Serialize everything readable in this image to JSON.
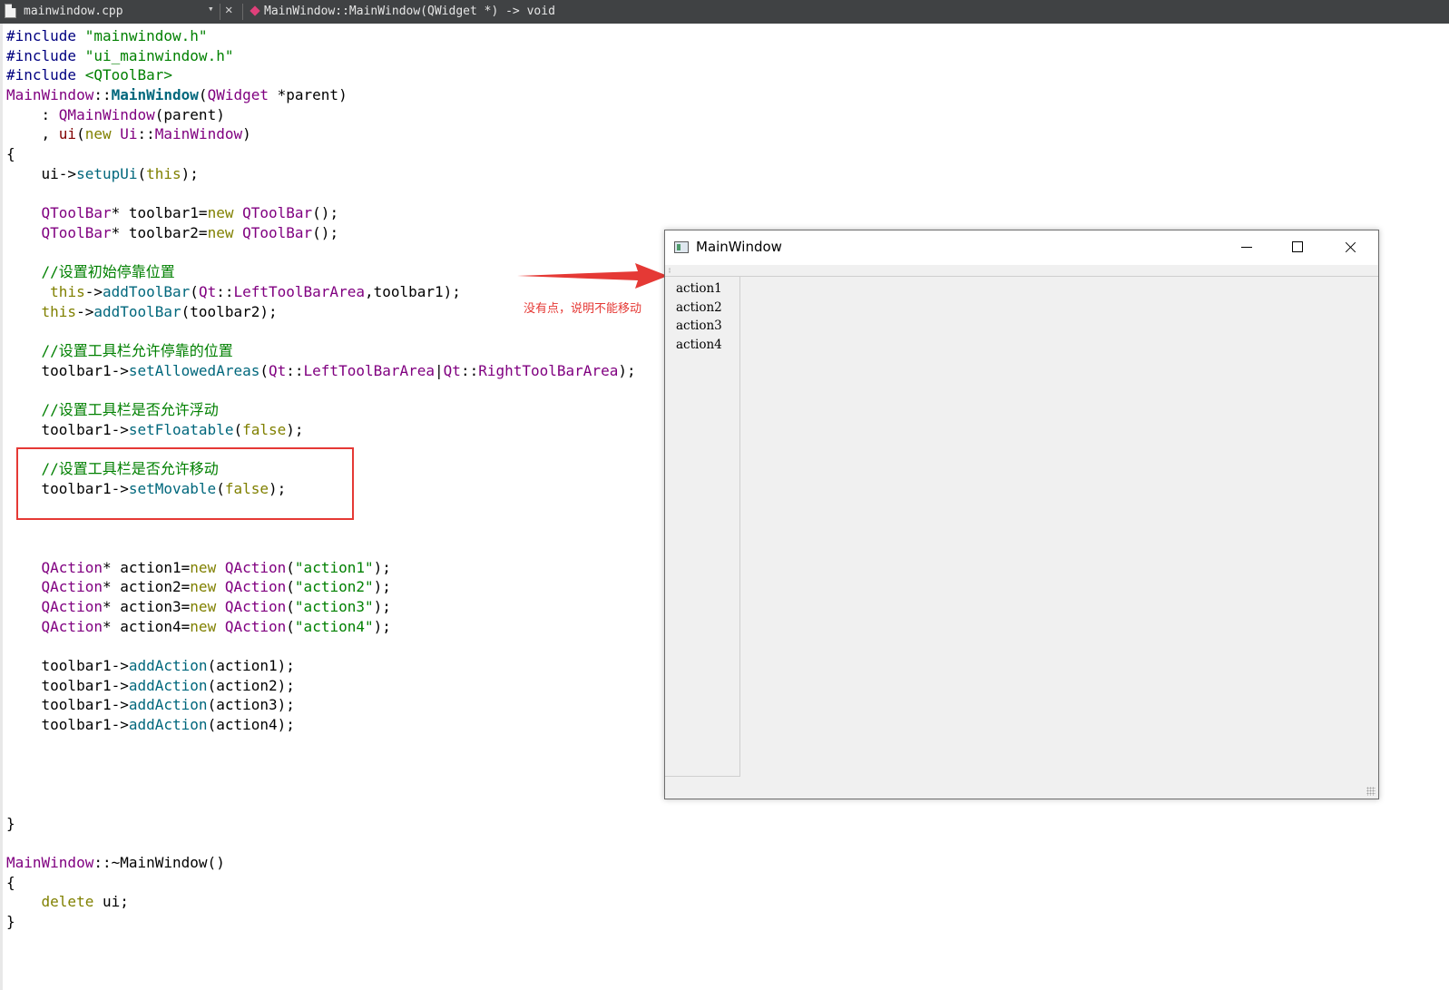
{
  "editor": {
    "tab_file": "mainwindow.cpp",
    "tab_symbol": "MainWindow::MainWindow(QWidget *) -> void"
  },
  "code_lines": [
    "#include \"mainwindow.h\"",
    "#include \"ui_mainwindow.h\"",
    "#include <QToolBar>",
    "MainWindow::MainWindow(QWidget *parent)",
    "    : QMainWindow(parent)",
    "    , ui(new Ui::MainWindow)",
    "{",
    "    ui->setupUi(this);",
    "",
    "    QToolBar* toolbar1=new QToolBar();",
    "    QToolBar* toolbar2=new QToolBar();",
    "",
    "    //设置初始停靠位置",
    "     this->addToolBar(Qt::LeftToolBarArea,toolbar1);",
    "    this->addToolBar(toolbar2);",
    "",
    "    //设置工具栏允许停靠的位置",
    "    toolbar1->setAllowedAreas(Qt::LeftToolBarArea|Qt::RightToolBarArea);",
    "",
    "    //设置工具栏是否允许浮动",
    "    toolbar1->setFloatable(false);",
    "",
    "    //设置工具栏是否允许移动",
    "    toolbar1->setMovable(false);",
    "",
    "",
    "",
    "    QAction* action1=new QAction(\"action1\");",
    "    QAction* action2=new QAction(\"action2\");",
    "    QAction* action3=new QAction(\"action3\");",
    "    QAction* action4=new QAction(\"action4\");",
    "",
    "    toolbar1->addAction(action1);",
    "    toolbar1->addAction(action2);",
    "    toolbar1->addAction(action3);",
    "    toolbar1->addAction(action4);",
    "",
    "",
    "",
    "",
    "}",
    "",
    "MainWindow::~MainWindow()",
    "{",
    "    delete ui;",
    "}"
  ],
  "annotation": "没有点，说明不能移动",
  "main_window": {
    "title": "MainWindow",
    "actions": [
      "action1",
      "action2",
      "action3",
      "action4"
    ]
  },
  "colors": {
    "tabbar_bg": "#404244",
    "annotation_red": "#e53935",
    "window_bg": "#f0f0f0"
  }
}
